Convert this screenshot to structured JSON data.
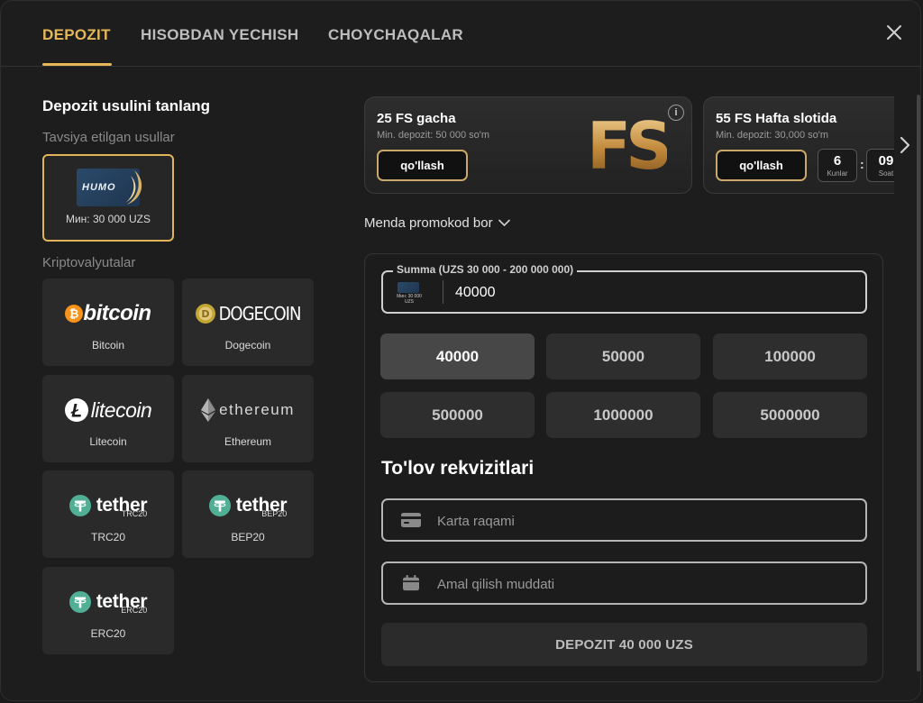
{
  "tabs": [
    {
      "label": "DEPOZIT",
      "active": true
    },
    {
      "label": "HISOBDAN YECHISH",
      "active": false
    },
    {
      "label": "CHOYCHAQALAR",
      "active": false
    }
  ],
  "left": {
    "title": "Depozit usulini tanlang",
    "recommended_label": "Tavsiya etilgan usullar",
    "recommended": [
      {
        "logo": "HUMO",
        "label": "Мин: 30 000 UZS",
        "selected": true
      }
    ],
    "crypto_label": "Kriptovalyutalar",
    "crypto": [
      {
        "logo_text": "bitcoin",
        "label": "Bitcoin"
      },
      {
        "logo_text": "DOGECOIN",
        "label": "Dogecoin"
      },
      {
        "logo_text": "litecoin",
        "label": "Litecoin"
      },
      {
        "logo_text": "ethereum",
        "label": "Ethereum"
      },
      {
        "logo_text": "tether",
        "logo_sub": "TRC20",
        "label": "TRC20"
      },
      {
        "logo_text": "tether",
        "logo_sub": "BEP20",
        "label": "BEP20"
      },
      {
        "logo_text": "tether",
        "logo_sub": "ERC20",
        "label": "ERC20"
      }
    ]
  },
  "promos": [
    {
      "title": "25 FS gacha",
      "subtitle": "Min. depozit: 50 000 so'm",
      "button": "qo'llash",
      "art_text": "FS",
      "info": "i"
    },
    {
      "title": "55 FS Hafta slotida",
      "subtitle": "Min. depozit: 30,000 so'm",
      "button": "qo'llash",
      "timer": [
        {
          "value": "6",
          "unit": "Kunlar"
        },
        {
          "value": "09",
          "unit": "Soat"
        }
      ],
      "separator": ":"
    }
  ],
  "promo_toggle": "Menda promokod bor",
  "form": {
    "amount_label": "Summa (UZS 30 000 - 200 000 000)",
    "amount_value": "40000",
    "amount_method_caption": "Мин: 30 000 UZS",
    "quick_amounts": [
      "40000",
      "50000",
      "100000",
      "500000",
      "1000000",
      "5000000"
    ],
    "selected_amount": "40000",
    "requisites_title": "To'lov rekvizitlari",
    "card_placeholder": "Karta raqami",
    "expiry_placeholder": "Amal qilish muddati",
    "submit_label": "DEPOZIT 40 000 UZS"
  },
  "colors": {
    "accent": "#e5b758",
    "background": "#1d1d1d",
    "card": "#2a2a2a"
  }
}
